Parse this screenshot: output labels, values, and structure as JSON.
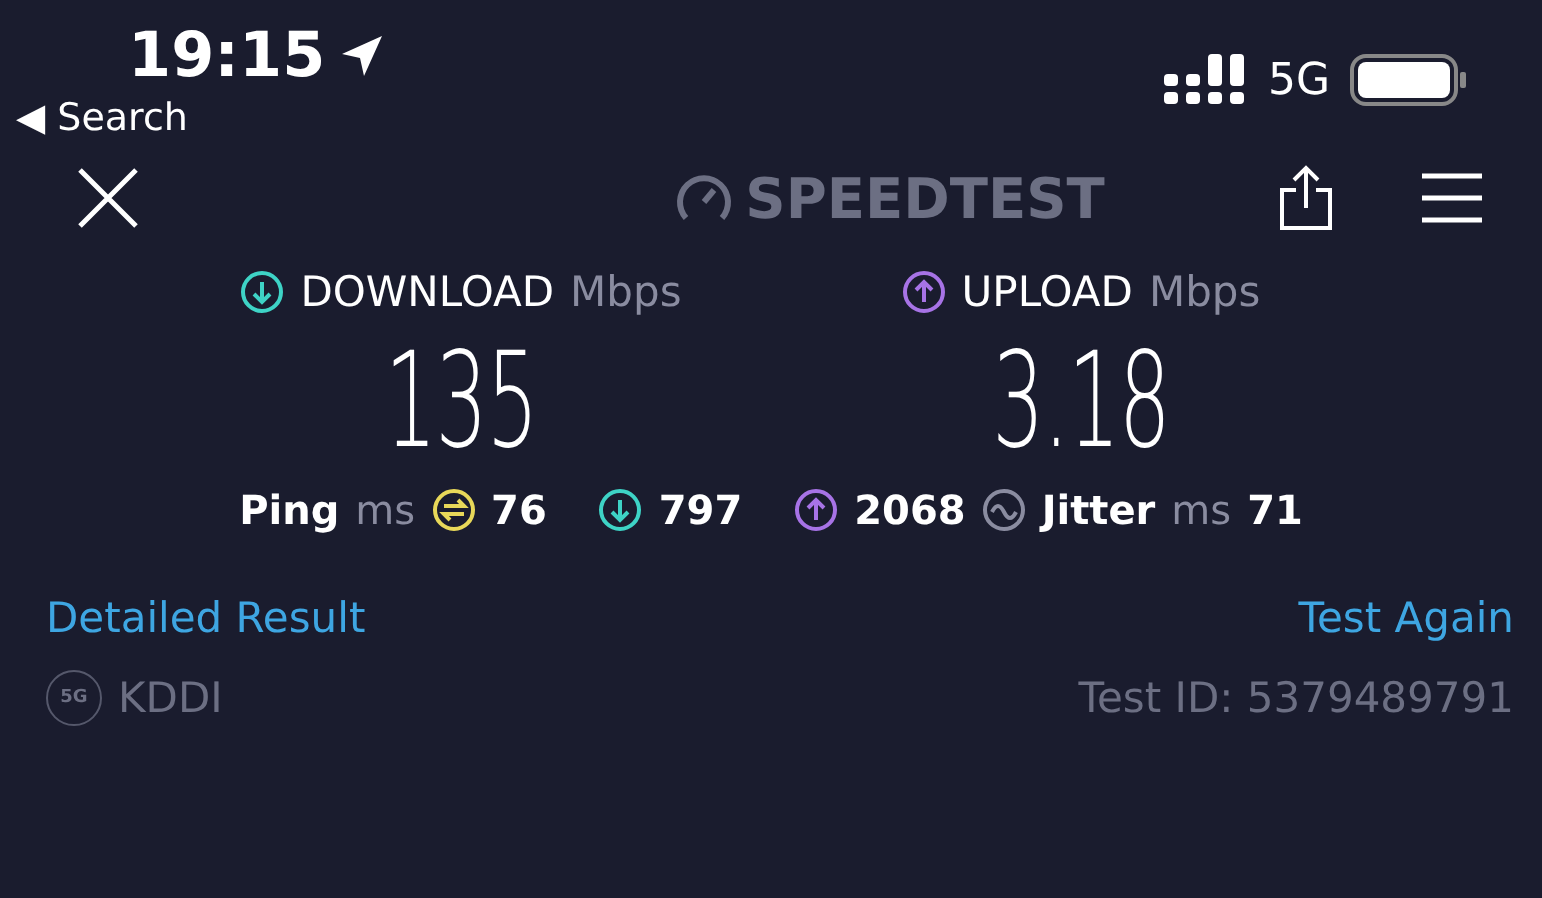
{
  "status_bar": {
    "time": "19:15",
    "back": "◀ Search",
    "network": "5G"
  },
  "nav": {
    "logo": "SPEEDTEST"
  },
  "results": [
    {
      "kind": "download",
      "label": "DOWNLOAD",
      "unit": "Mbps",
      "value": "135",
      "color": "#3ed3c6"
    },
    {
      "kind": "upload",
      "label": "UPLOAD",
      "unit": "Mbps",
      "value": "3.18",
      "color": "#a773e6"
    }
  ],
  "ping": {
    "label": "Ping",
    "unit": "ms",
    "idle": "76",
    "download": "797",
    "upload": "2068"
  },
  "jitter": {
    "label": "Jitter",
    "unit": "ms",
    "value": "71"
  },
  "links": {
    "detail": "Detailed Result",
    "again": "Test Again"
  },
  "provider": {
    "badge": "5G",
    "name": "KDDI",
    "test_id": "Test ID: 5379489791"
  }
}
